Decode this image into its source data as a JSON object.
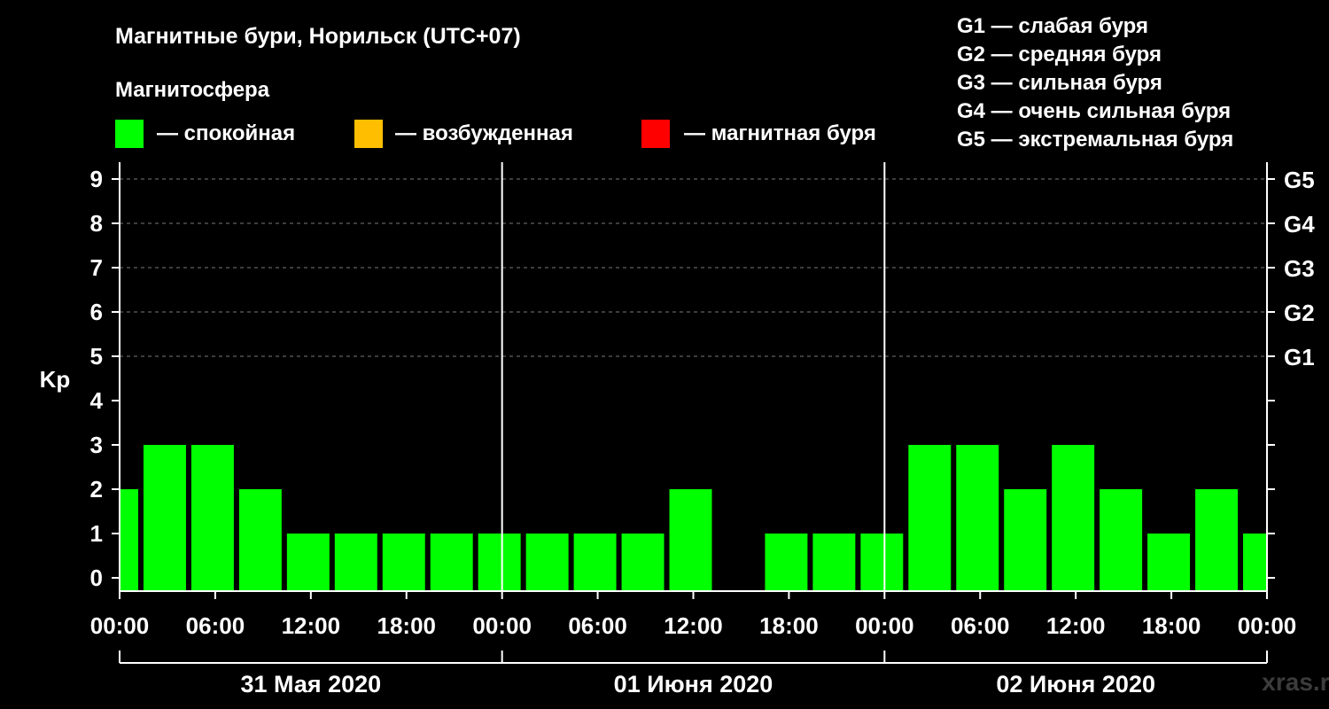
{
  "chart_data": {
    "type": "bar",
    "title": "Магнитные бури, Норильск (UTC+07)",
    "ylabel": "Kp",
    "ylim": [
      0,
      9
    ],
    "yticks": [
      0,
      1,
      2,
      3,
      4,
      5,
      6,
      7,
      8,
      9
    ],
    "legend": {
      "heading": "Магнитосфера",
      "placement": "top-left",
      "items": [
        {
          "color": "#00ff00",
          "label": "— спокойная"
        },
        {
          "color": "#ffbf00",
          "label": "— возбужденная"
        },
        {
          "color": "#ff0000",
          "label": "— магнитная буря"
        }
      ]
    },
    "g_scale": {
      "placement": "top-right",
      "items": [
        "G1 — слабая буря",
        "G2 — средняя буря",
        "G3 — сильная буря",
        "G4 — очень сильная буря",
        "G5 — экстремальная буря"
      ],
      "right_axis": [
        {
          "label": "G1",
          "kp": 5
        },
        {
          "label": "G2",
          "kp": 6
        },
        {
          "label": "G3",
          "kp": 7
        },
        {
          "label": "G4",
          "kp": 8
        },
        {
          "label": "G5",
          "kp": 9
        }
      ]
    },
    "x_hours_range": [
      0,
      72
    ],
    "x_tick_labels": [
      "00:00",
      "06:00",
      "12:00",
      "18:00",
      "00:00",
      "06:00",
      "12:00",
      "18:00",
      "00:00",
      "06:00",
      "12:00",
      "18:00",
      "00:00"
    ],
    "days": [
      "31 Мая 2020",
      "01 Июня 2020",
      "02 Июня 2020"
    ],
    "grid": true,
    "series": [
      {
        "values": [
          2,
          3,
          3,
          2,
          1,
          1,
          1,
          1,
          1,
          1,
          1,
          1,
          2,
          0,
          1,
          1,
          1,
          3,
          3,
          2,
          3,
          2,
          1,
          2,
          1
        ],
        "bar_start_hours": [
          -1.5,
          1.5,
          4.5,
          7.5,
          10.5,
          13.5,
          16.5,
          19.5,
          22.5,
          25.5,
          28.5,
          31.5,
          34.5,
          37.5,
          40.5,
          43.5,
          46.5,
          49.5,
          52.5,
          55.5,
          58.5,
          61.5,
          64.5,
          67.5,
          70.5
        ],
        "bar_width_hours": 2.667,
        "color": "#00ff00"
      }
    ]
  },
  "watermark": "xras.ru"
}
